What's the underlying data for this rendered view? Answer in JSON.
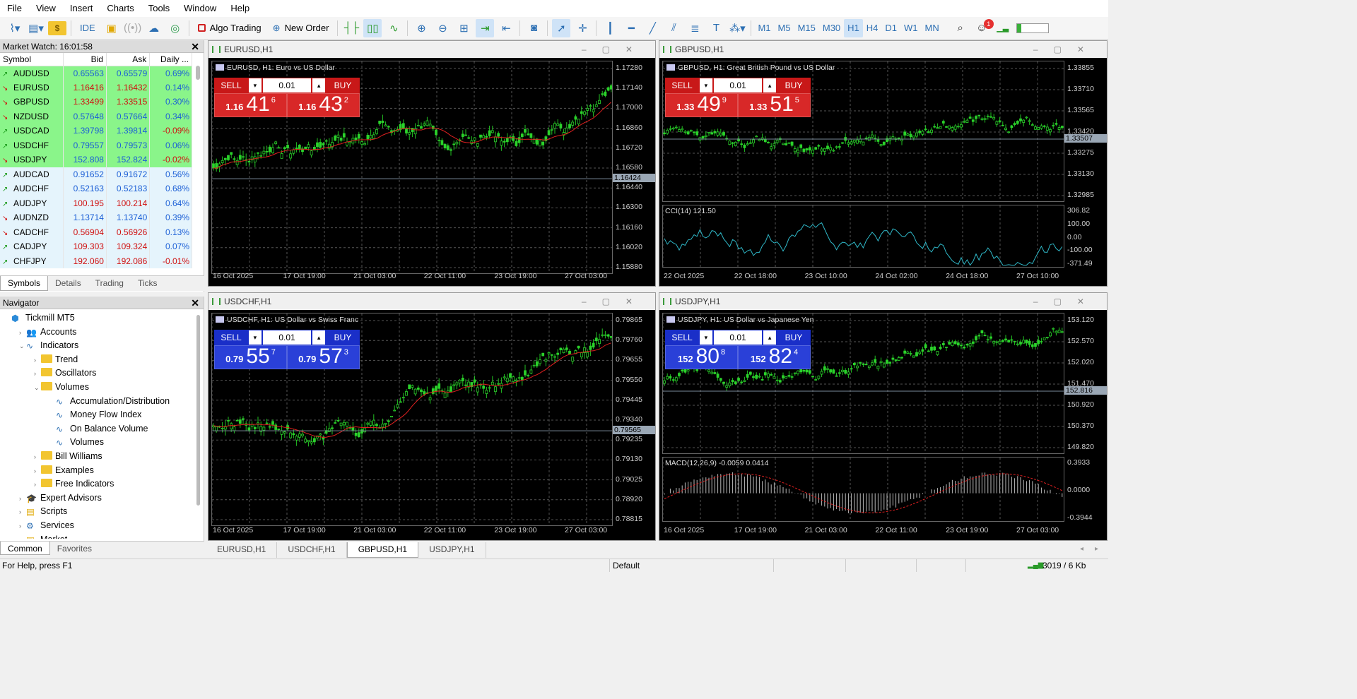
{
  "menu": [
    "File",
    "View",
    "Insert",
    "Charts",
    "Tools",
    "Window",
    "Help"
  ],
  "toolbar": {
    "ide": "IDE",
    "algo": "Algo Trading",
    "neworder": "New Order",
    "timeframes": [
      "M1",
      "M5",
      "M15",
      "M30",
      "H1",
      "H4",
      "D1",
      "W1",
      "MN"
    ],
    "active_tf": "H1",
    "notif_count": "1"
  },
  "market_watch": {
    "title": "Market Watch: 16:01:58",
    "columns": [
      "Symbol",
      "Bid",
      "Ask",
      "Daily ..."
    ],
    "rows": [
      {
        "s": "AUDUSD",
        "b": "0.65563",
        "a": "0.65579",
        "d": "0.69%",
        "dir": "u",
        "bc": "up",
        "hl": "g"
      },
      {
        "s": "EURUSD",
        "b": "1.16416",
        "a": "1.16432",
        "d": "0.14%",
        "dir": "d",
        "bc": "dn",
        "hl": "g"
      },
      {
        "s": "GBPUSD",
        "b": "1.33499",
        "a": "1.33515",
        "d": "0.30%",
        "dir": "d",
        "bc": "dn",
        "hl": "g"
      },
      {
        "s": "NZDUSD",
        "b": "0.57648",
        "a": "0.57664",
        "d": "0.34%",
        "dir": "d",
        "bc": "up",
        "hl": "g"
      },
      {
        "s": "USDCAD",
        "b": "1.39798",
        "a": "1.39814",
        "d": "-0.09%",
        "dir": "u",
        "bc": "up",
        "hl": "g"
      },
      {
        "s": "USDCHF",
        "b": "0.79557",
        "a": "0.79573",
        "d": "0.06%",
        "dir": "u",
        "bc": "up",
        "hl": "g"
      },
      {
        "s": "USDJPY",
        "b": "152.808",
        "a": "152.824",
        "d": "-0.02%",
        "dir": "d",
        "bc": "up",
        "hl": "g"
      },
      {
        "s": "AUDCAD",
        "b": "0.91652",
        "a": "0.91672",
        "d": "0.56%",
        "dir": "u",
        "bc": "up",
        "hl": "l"
      },
      {
        "s": "AUDCHF",
        "b": "0.52163",
        "a": "0.52183",
        "d": "0.68%",
        "dir": "u",
        "bc": "up",
        "hl": "l"
      },
      {
        "s": "AUDJPY",
        "b": "100.195",
        "a": "100.214",
        "d": "0.64%",
        "dir": "u",
        "bc": "dn",
        "hl": "l"
      },
      {
        "s": "AUDNZD",
        "b": "1.13714",
        "a": "1.13740",
        "d": "0.39%",
        "dir": "d",
        "bc": "up",
        "hl": "l"
      },
      {
        "s": "CADCHF",
        "b": "0.56904",
        "a": "0.56926",
        "d": "0.13%",
        "dir": "d",
        "bc": "dn",
        "hl": "l"
      },
      {
        "s": "CADJPY",
        "b": "109.303",
        "a": "109.324",
        "d": "0.07%",
        "dir": "u",
        "bc": "dn",
        "hl": "l"
      },
      {
        "s": "CHFJPY",
        "b": "192.060",
        "a": "192.086",
        "d": "-0.01%",
        "dir": "u",
        "bc": "dn",
        "hl": "l"
      }
    ],
    "tabs": [
      "Symbols",
      "Details",
      "Trading",
      "Ticks"
    ]
  },
  "navigator": {
    "title": "Navigator",
    "items": [
      {
        "t": "Tickmill MT5",
        "lvl": 0,
        "ic": "broker",
        "tg": ""
      },
      {
        "t": "Accounts",
        "lvl": 1,
        "ic": "accounts",
        "tg": "›"
      },
      {
        "t": "Indicators",
        "lvl": 1,
        "ic": "ind",
        "tg": "⌄"
      },
      {
        "t": "Trend",
        "lvl": 2,
        "ic": "folder",
        "tg": "›"
      },
      {
        "t": "Oscillators",
        "lvl": 2,
        "ic": "folder",
        "tg": "›"
      },
      {
        "t": "Volumes",
        "lvl": 2,
        "ic": "folder",
        "tg": "⌄"
      },
      {
        "t": "Accumulation/Distribution",
        "lvl": 3,
        "ic": "ind",
        "tg": ""
      },
      {
        "t": "Money Flow Index",
        "lvl": 3,
        "ic": "ind",
        "tg": ""
      },
      {
        "t": "On Balance Volume",
        "lvl": 3,
        "ic": "ind",
        "tg": ""
      },
      {
        "t": "Volumes",
        "lvl": 3,
        "ic": "ind",
        "tg": ""
      },
      {
        "t": "Bill Williams",
        "lvl": 2,
        "ic": "folder",
        "tg": "›"
      },
      {
        "t": "Examples",
        "lvl": 2,
        "ic": "folder",
        "tg": "›"
      },
      {
        "t": "Free Indicators",
        "lvl": 2,
        "ic": "folder",
        "tg": "›"
      },
      {
        "t": "Expert Advisors",
        "lvl": 1,
        "ic": "ea",
        "tg": "›"
      },
      {
        "t": "Scripts",
        "lvl": 1,
        "ic": "scripts",
        "tg": "›"
      },
      {
        "t": "Services",
        "lvl": 1,
        "ic": "services",
        "tg": "›"
      },
      {
        "t": "Market",
        "lvl": 1,
        "ic": "market",
        "tg": "›"
      }
    ],
    "tabs": [
      "Common",
      "Favorites"
    ]
  },
  "charts": [
    {
      "id": "eur",
      "title": "EURUSD,H1",
      "desc": "EURUSD, H1:  Euro vs US Dollar",
      "theme": "red",
      "sell": "SELL",
      "buy": "BUY",
      "lot": "0.01",
      "bid": {
        "a": "1.16",
        "b": "41",
        "c": "6"
      },
      "ask": {
        "a": "1.16",
        "b": "43",
        "c": "2"
      },
      "yticks": [
        "1.17280",
        "1.17140",
        "1.17000",
        "1.16860",
        "1.16720",
        "1.16580",
        "1.16440",
        "1.16300",
        "1.16160",
        "1.16020",
        "1.15880"
      ],
      "price": "1.16424",
      "xticks": [
        "16 Oct 2025",
        "17 Oct 19:00",
        "21 Oct 03:00",
        "22 Oct 11:00",
        "23 Oct 19:00",
        "27 Oct 03:00"
      ]
    },
    {
      "id": "gbp",
      "title": "GBPUSD,H1",
      "desc": "GBPUSD, H1:  Great British Pound vs US Dollar",
      "theme": "red",
      "sell": "SELL",
      "buy": "BUY",
      "lot": "0.01",
      "bid": {
        "a": "1.33",
        "b": "49",
        "c": "9"
      },
      "ask": {
        "a": "1.33",
        "b": "51",
        "c": "5"
      },
      "yticks": [
        "1.33855",
        "1.33710",
        "1.33565",
        "1.33420",
        "1.33275",
        "1.33130",
        "1.32985"
      ],
      "price": "1.33507",
      "ind_label": "CCI(14) 121.50",
      "ind_ticks": [
        "306.82",
        "100.00",
        "0.00",
        "-100.00",
        "-371.49"
      ],
      "xticks": [
        "22 Oct 2025",
        "22 Oct 18:00",
        "23 Oct 10:00",
        "24 Oct 02:00",
        "24 Oct 18:00",
        "27 Oct 10:00"
      ]
    },
    {
      "id": "chf",
      "title": "USDCHF,H1",
      "desc": "USDCHF, H1:  US Dollar vs Swiss Franc",
      "theme": "blue",
      "sell": "SELL",
      "buy": "BUY",
      "lot": "0.01",
      "bid": {
        "a": "0.79",
        "b": "55",
        "c": "7"
      },
      "ask": {
        "a": "0.79",
        "b": "57",
        "c": "3"
      },
      "yticks": [
        "0.79865",
        "0.79760",
        "0.79655",
        "0.79550",
        "0.79445",
        "0.79340",
        "0.79235",
        "0.79130",
        "0.79025",
        "0.78920",
        "0.78815"
      ],
      "price": "0.79565",
      "xticks": [
        "16 Oct 2025",
        "17 Oct 19:00",
        "21 Oct 03:00",
        "22 Oct 11:00",
        "23 Oct 19:00",
        "27 Oct 03:00"
      ]
    },
    {
      "id": "jpy",
      "title": "USDJPY,H1",
      "desc": "USDJPY, H1:  US Dollar vs Japanese Yen",
      "theme": "blue",
      "sell": "SELL",
      "buy": "BUY",
      "lot": "0.01",
      "bid": {
        "a": "152",
        "b": "80",
        "c": "8"
      },
      "ask": {
        "a": "152",
        "b": "82",
        "c": "4"
      },
      "yticks": [
        "153.120",
        "152.570",
        "152.020",
        "151.470",
        "150.920",
        "150.370",
        "149.820"
      ],
      "price": "152.816",
      "ind_label": "MACD(12,26,9) -0.0059 0.0414",
      "ind_ticks": [
        "0.3933",
        "0.0000",
        "-0.3944"
      ],
      "xticks": [
        "16 Oct 2025",
        "17 Oct 19:00",
        "21 Oct 03:00",
        "22 Oct 11:00",
        "23 Oct 19:00",
        "27 Oct 03:00"
      ]
    }
  ],
  "chart_tabs": [
    "EURUSD,H1",
    "USDCHF,H1",
    "GBPUSD,H1",
    "USDJPY,H1"
  ],
  "active_chart_tab": "GBPUSD,H1",
  "status": {
    "help": "For Help, press F1",
    "profile": "Default",
    "traffic": "3019 / 6 Kb"
  }
}
